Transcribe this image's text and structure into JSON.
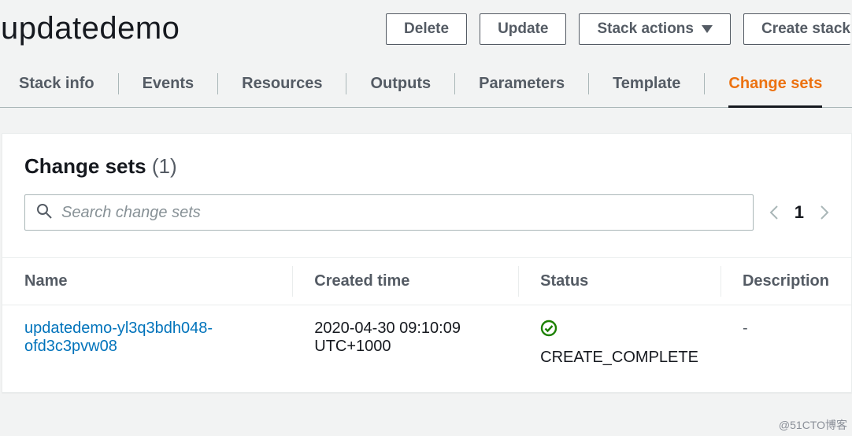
{
  "header": {
    "title": "updatedemo",
    "buttons": {
      "delete": "Delete",
      "update": "Update",
      "stack_actions": "Stack actions",
      "create_stack": "Create stack"
    }
  },
  "tabs": {
    "stack_info": "Stack info",
    "events": "Events",
    "resources": "Resources",
    "outputs": "Outputs",
    "parameters": "Parameters",
    "template": "Template",
    "change_sets": "Change sets"
  },
  "panel": {
    "title": "Change sets",
    "count_display": "(1)",
    "search_placeholder": "Search change sets",
    "page_number": "1"
  },
  "table": {
    "headers": {
      "name": "Name",
      "created_time": "Created time",
      "status": "Status",
      "description": "Description"
    },
    "rows": [
      {
        "name": "updatedemo-yl3q3bdh048-ofd3c3pvw08",
        "created_time": "2020-04-30 09:10:09 UTC+1000",
        "status": "CREATE_COMPLETE",
        "description": "-"
      }
    ]
  },
  "watermark": "@51CTO博客"
}
